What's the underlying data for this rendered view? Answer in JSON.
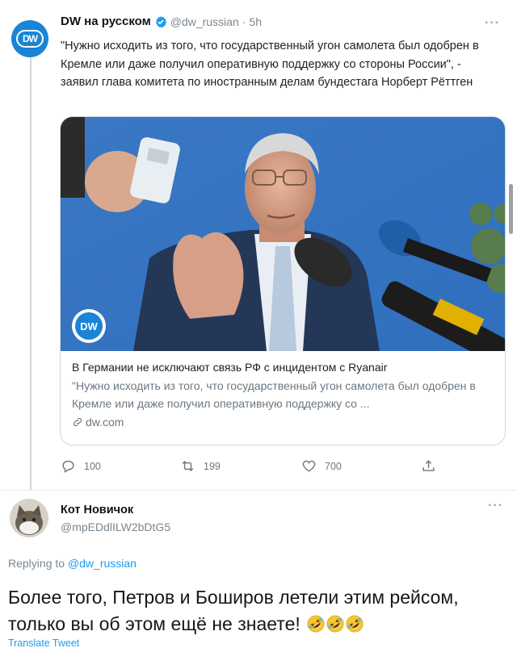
{
  "tweet": {
    "author_name": "DW на русском",
    "handle": "@dw_russian",
    "separator": "·",
    "time": "5h",
    "avatar_text": "DW",
    "text": "\"Нужно исходить из того, что государственный угон самолета был одобрен в Кремле или даже получил оперативную поддержку со стороны России\", - заявил глава комитета по иностранным делам бундестага Норберт Рёттген",
    "card": {
      "logo_text": "DW",
      "title": "В Германии не исключают связь РФ с инцидентом с Ryanair",
      "description": "\"Нужно исходить из того, что государственный угон самолета был одобрен в Кремле или даже получил оперативную поддержку со ...",
      "domain": "dw.com"
    },
    "actions": {
      "replies": "100",
      "retweets": "199",
      "likes": "700"
    },
    "more_icon": "ellipsis-icon"
  },
  "reply": {
    "author_name": "Кот Новичок",
    "handle": "@mpEDdlILW2bDtG5",
    "replying_prefix": "Replying to",
    "replying_to": "@dw_russian",
    "text": "Более того, Петров и Боширов летели этим рейсом, только вы об этом ещё не знаете!",
    "emoji": [
      "rolling-laughing",
      "rolling-laughing",
      "rolling-laughing"
    ],
    "translate": "Translate Tweet"
  },
  "colors": {
    "accent": "#1d9bf0",
    "dw_blue": "#1a84d6",
    "secondary_text": "#7a8791"
  }
}
